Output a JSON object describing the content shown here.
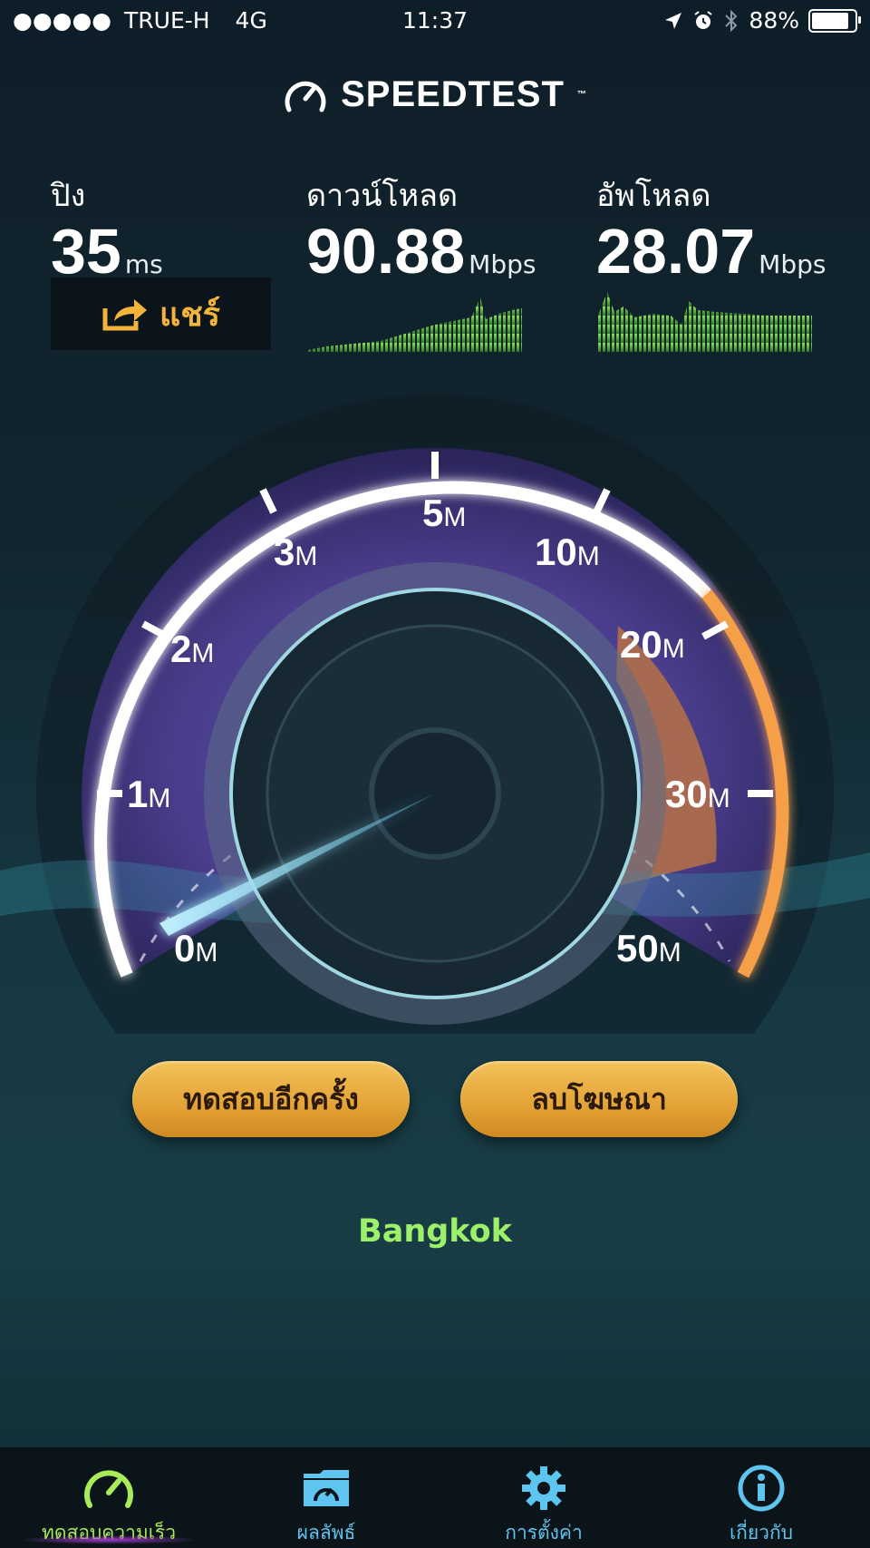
{
  "status_bar": {
    "signal": "●●●●●",
    "carrier": "TRUE-H",
    "network": "4G",
    "time": "11:37",
    "battery": "88%",
    "battery_level": 0.88
  },
  "app": {
    "logo_text": "SPEEDTEST",
    "logo_tm": "™"
  },
  "metrics": {
    "ping": {
      "label": "ปิง",
      "value": "35",
      "unit": "ms"
    },
    "download": {
      "label": "ดาวน์โหลด",
      "value": "90.88",
      "unit": "Mbps"
    },
    "upload": {
      "label": "อัพโหลด",
      "value": "28.07",
      "unit": "Mbps"
    }
  },
  "share_button": {
    "label": "แชร์",
    "icon": "share-icon"
  },
  "gauge": {
    "ticks": [
      {
        "num": "0",
        "unit": "M"
      },
      {
        "num": "1",
        "unit": "M"
      },
      {
        "num": "2",
        "unit": "M"
      },
      {
        "num": "3",
        "unit": "M"
      },
      {
        "num": "5",
        "unit": "M"
      },
      {
        "num": "10",
        "unit": "M"
      },
      {
        "num": "20",
        "unit": "M"
      },
      {
        "num": "30",
        "unit": "M"
      },
      {
        "num": "50",
        "unit": "M"
      }
    ],
    "needle_fraction": 0.05
  },
  "buttons": {
    "retest": "ทดสอบอีกครั้ง",
    "remove_ads": "ลบโฆษณา"
  },
  "server": {
    "location": "Bangkok"
  },
  "tabbar": {
    "items": [
      {
        "label": "ทดสอบความเร็ว",
        "icon": "speedometer-icon",
        "active": true
      },
      {
        "label": "ผลลัพธ์",
        "icon": "results-folder-icon",
        "active": false
      },
      {
        "label": "การตั้งค่า",
        "icon": "gear-icon",
        "active": false
      },
      {
        "label": "เกี่ยวกับ",
        "icon": "info-icon",
        "active": false
      }
    ]
  },
  "colors": {
    "accent_green": "#9df06a",
    "accent_blue": "#5ec4f0",
    "button_gold": "#e3a235",
    "gauge_orange": "#f0903a",
    "gauge_purple": "#7a55c8"
  }
}
